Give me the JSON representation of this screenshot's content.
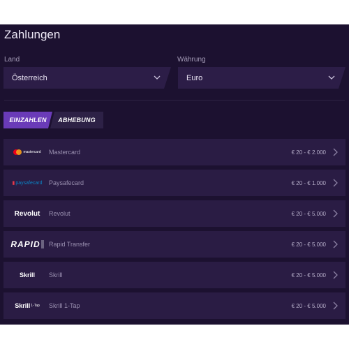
{
  "page": {
    "title": "Zahlungen"
  },
  "country": {
    "label": "Land",
    "value": "Österreich"
  },
  "currency": {
    "label": "Währung",
    "value": "Euro"
  },
  "tabs": [
    {
      "label": "EINZAHLEN",
      "active": true
    },
    {
      "label": "ABHEBUNG",
      "active": false
    }
  ],
  "methods": [
    {
      "logo": "mastercard",
      "logo_text": "mastercard",
      "name": "Mastercard",
      "range": "€ 20 - € 2.000"
    },
    {
      "logo": "paysafecard",
      "logo_text": "paysafecard",
      "name": "Paysafecard",
      "range": "€ 20 - € 1.000"
    },
    {
      "logo": "revolut",
      "logo_text": "Revolut",
      "name": "Revolut",
      "range": "€ 20 - € 5.000"
    },
    {
      "logo": "rapid",
      "logo_text": "RAPID",
      "name": "Rapid Transfer",
      "range": "€ 20 - € 5.000"
    },
    {
      "logo": "skrill",
      "logo_text": "Skrill",
      "name": "Skrill",
      "range": "€ 20 - € 5.000"
    },
    {
      "logo": "skrill-1tap",
      "logo_text": "Skrill",
      "logo_suffix": "1-Tap",
      "name": "Skrill 1-Tap",
      "range": "€ 20 - € 5.000"
    }
  ],
  "colors": {
    "background": "#1c1130",
    "row": "#2a1c44",
    "accent": "#6a3bb8",
    "input": "#2c1d47"
  }
}
